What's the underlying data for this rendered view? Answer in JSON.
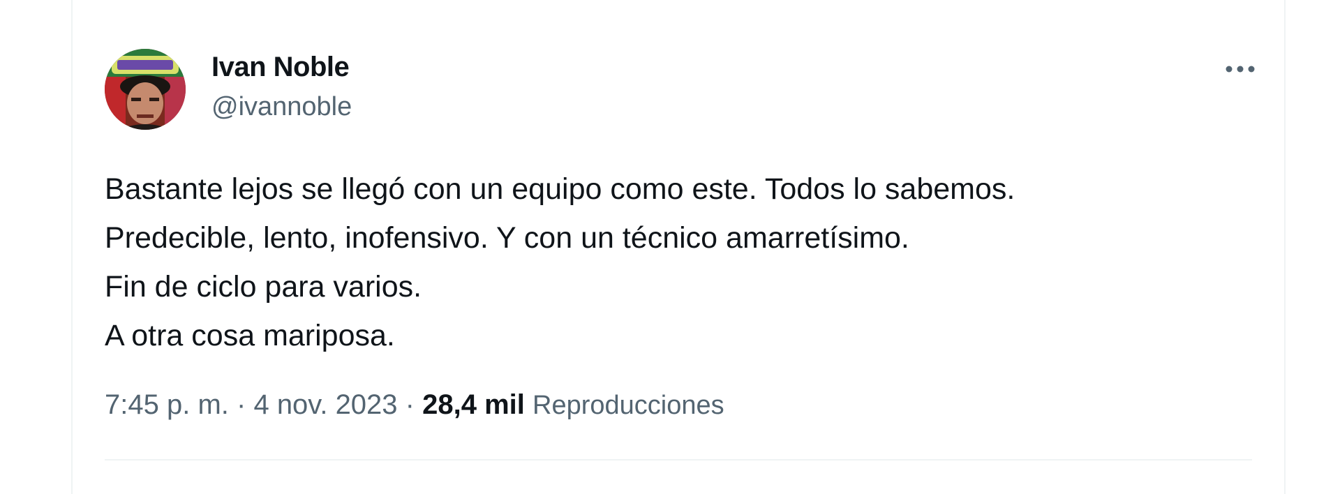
{
  "author": {
    "display_name": "Ivan Noble",
    "handle": "@ivannoble",
    "avatar_icon": "profile-photo"
  },
  "tweet": {
    "lines": [
      "Bastante lejos se llegó con un equipo como este. Todos lo sabemos.",
      "Predecible, lento, inofensivo. Y con un técnico amarretísimo.",
      "Fin de ciclo para varios.",
      "A otra cosa mariposa."
    ]
  },
  "meta": {
    "time": "7:45 p. m.",
    "separator": "·",
    "date": "4 nov. 2023",
    "views_count": "28,4 mil",
    "views_label": "Reproducciones"
  },
  "more_icon": "more-horizontal-icon",
  "colors": {
    "text_primary": "#0f1419",
    "text_secondary": "#536471",
    "border": "#eff3f4"
  }
}
